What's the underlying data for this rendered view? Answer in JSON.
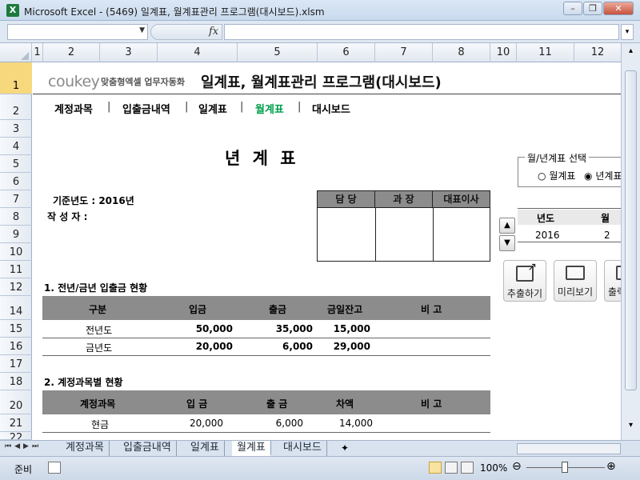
{
  "window": {
    "title": "Microsoft Excel - (5469) 일계표, 월계표관리 프로그램(대시보드).xlsm",
    "app_icon": "X"
  },
  "formula_bar": {
    "name_box": "",
    "fx": "fx",
    "formula": ""
  },
  "columns": [
    "1",
    "2",
    "3",
    "4",
    "5",
    "6",
    "7",
    "8",
    "10",
    "11",
    "12"
  ],
  "rows": [
    "1",
    "2",
    "3",
    "4",
    "5",
    "6",
    "7",
    "8",
    "9",
    "10",
    "11",
    "12",
    "14",
    "15",
    "16",
    "17",
    "18",
    "20",
    "21",
    "22"
  ],
  "header": {
    "logo": "coukey",
    "tagline": "맞춤형엑셀 업무자동화",
    "title": "일계표, 월계표관리 프로그램(대시보드)"
  },
  "nav": {
    "items": [
      "계정과목",
      "입출금내역",
      "일계표",
      "월계표",
      "대시보드"
    ],
    "separator": "|",
    "active_index": 3
  },
  "report": {
    "title": "년 계 표",
    "base_year_label": "기준년도 : 2016년",
    "author_label": "작 성 자 :",
    "approval": [
      "담 당",
      "과 장",
      "대표이사"
    ]
  },
  "selector": {
    "legend": "월/년계표 선택",
    "option_month": "월계표",
    "option_year": "년계표",
    "selected": "year"
  },
  "period_table": {
    "headers": [
      "년도",
      "월"
    ],
    "values": [
      "2016",
      "2"
    ]
  },
  "action_buttons": [
    "추출하기",
    "미리보기",
    "출력"
  ],
  "section1": {
    "title": "1. 전년/금년 입출금 현황",
    "headers": [
      "구분",
      "입금",
      "출금",
      "금일잔고",
      "비 고"
    ],
    "rows": [
      [
        "전년도",
        "50,000",
        "35,000",
        "15,000",
        ""
      ],
      [
        "금년도",
        "20,000",
        "6,000",
        "29,000",
        ""
      ]
    ]
  },
  "section2": {
    "title": "2. 계정과목별 현황",
    "headers": [
      "계정과목",
      "입 금",
      "출 금",
      "차액",
      "비 고"
    ],
    "rows": [
      [
        "현금",
        "20,000",
        "6,000",
        "14,000",
        ""
      ]
    ]
  },
  "sheet_tabs": [
    "계정과목",
    "입출금내역",
    "일계표",
    "월계표",
    "대시보드"
  ],
  "active_tab": 3,
  "status": {
    "ready": "준비",
    "zoom": "100%"
  },
  "colors": {
    "accent_green": "#00a04b",
    "header_gray": "#8c8c8c",
    "row_select": "#f7d87d"
  }
}
